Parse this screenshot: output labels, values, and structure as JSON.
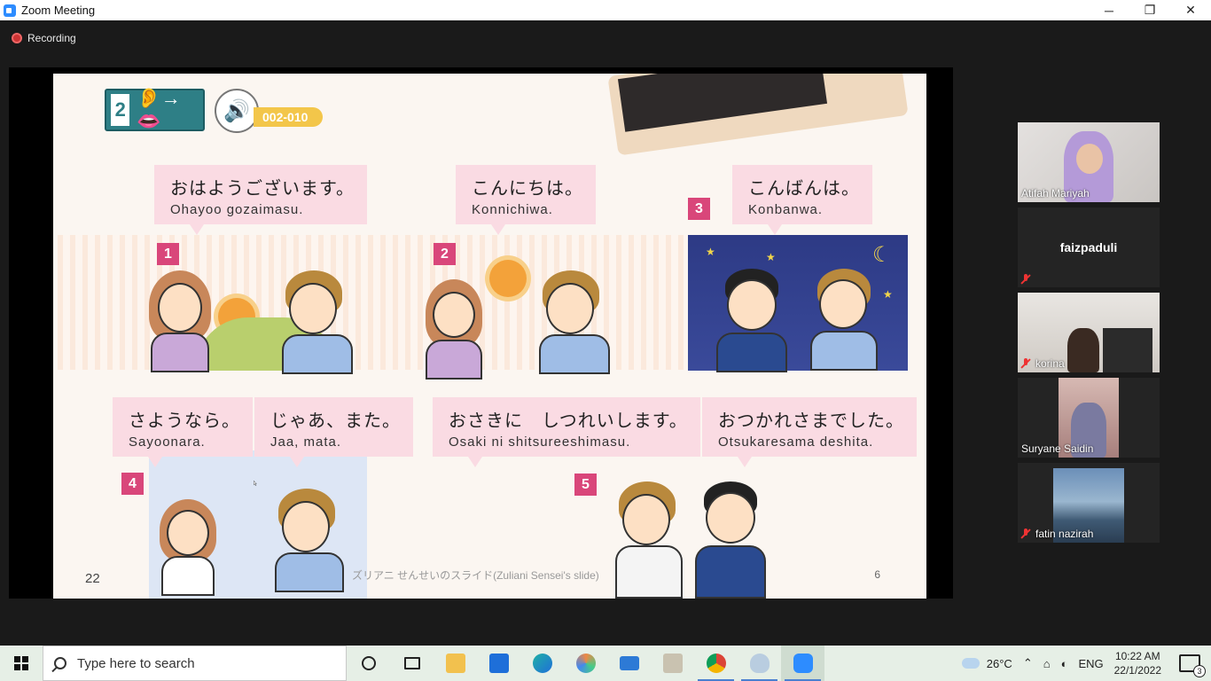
{
  "window": {
    "title": "Zoom Meeting",
    "controls": {
      "minimize": "─",
      "restore": "❐",
      "close": "✕"
    }
  },
  "meeting": {
    "recording_label": "Recording"
  },
  "slide": {
    "lesson_number": "2",
    "lesson_icon": "ear-to-mouth-icon",
    "audio_track": "002-010",
    "greetings": [
      {
        "number": "1",
        "japanese": "おはようございます。",
        "romaji": "Ohayoo gozaimasu."
      },
      {
        "number": "2",
        "japanese": "こんにちは。",
        "romaji": "Konnichiwa."
      },
      {
        "number": "3",
        "japanese": "こんばんは。",
        "romaji": "Konbanwa."
      },
      {
        "number": "4",
        "japanese": "さようなら。",
        "romaji": "Sayoonara."
      },
      {
        "number": "",
        "japanese": "じゃあ、また。",
        "romaji": "Jaa, mata."
      },
      {
        "number": "5",
        "japanese": "おさきに　しつれいします。",
        "romaji": "Osaki ni shitsureeshimasu."
      },
      {
        "number": "",
        "japanese": "おつかれさまでした。",
        "romaji": "Otsukaresama deshita."
      }
    ],
    "page_left": "22",
    "page_right": "6",
    "caption": "ズリアニ せんせいのスライド(Zuliani Sensei's slide)"
  },
  "participants": [
    {
      "name": "Atifah Mariyah",
      "muted": false,
      "video": true
    },
    {
      "name": "faizpaduli",
      "muted": true,
      "video": false
    },
    {
      "name": "korina",
      "muted": true,
      "video": true
    },
    {
      "name": "Suryane Saidin",
      "muted": false,
      "video": true
    },
    {
      "name": "fatin nazirah",
      "muted": true,
      "video": true
    }
  ],
  "taskbar": {
    "search_placeholder": "Type here to search",
    "pinned": [
      "cortana-icon",
      "task-view-icon",
      "file-explorer-icon",
      "microsoft-store-icon",
      "edge-icon",
      "photos-icon",
      "mail-icon",
      "notepad-icon",
      "chrome-icon",
      "paint-icon",
      "zoom-icon"
    ],
    "temperature": "26°C",
    "language": "ENG",
    "time": "10:22 AM",
    "date": "22/1/2022",
    "notification_count": "3"
  },
  "colors": {
    "zoom_blue": "#2d8cff",
    "bubble_pink": "#fadbe3",
    "number_tag": "#d9467a",
    "taskbar_bg": "#e6efe6"
  }
}
